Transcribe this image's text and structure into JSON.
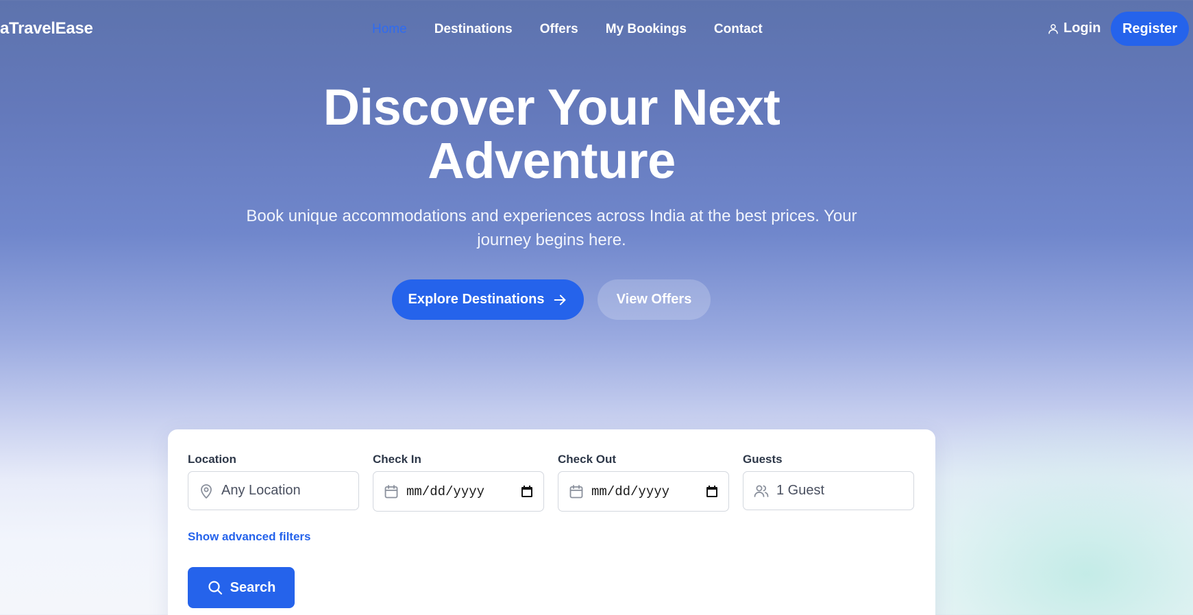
{
  "header": {
    "brand": "aTravelEase",
    "nav": [
      {
        "label": "Home",
        "active": true
      },
      {
        "label": "Destinations",
        "active": false
      },
      {
        "label": "Offers",
        "active": false
      },
      {
        "label": "My Bookings",
        "active": false
      },
      {
        "label": "Contact",
        "active": false
      }
    ],
    "login_label": "Login",
    "register_label": "Register"
  },
  "hero": {
    "title_line1": "Discover Your Next",
    "title_line2": "Adventure",
    "subtitle": "Book unique accommodations and experiences across India at the best prices. Your journey begins here.",
    "explore_label": "Explore Destinations",
    "offers_label": "View Offers"
  },
  "search": {
    "location_label": "Location",
    "location_placeholder": "Any Location",
    "checkin_label": "Check In",
    "checkin_value": "mm/dd/yyyy",
    "checkout_label": "Check Out",
    "checkout_value": "mm/dd/yyyy",
    "guests_label": "Guests",
    "guests_value": "1 Guest",
    "advanced_link": "Show advanced filters",
    "search_label": "Search"
  },
  "colors": {
    "accent": "#2563eb",
    "active_nav": "#2f6bf0"
  },
  "icons": [
    "user-icon",
    "arrow-right-icon",
    "map-pin-icon",
    "calendar-icon",
    "calendar-picker-icon",
    "users-icon",
    "search-icon"
  ]
}
